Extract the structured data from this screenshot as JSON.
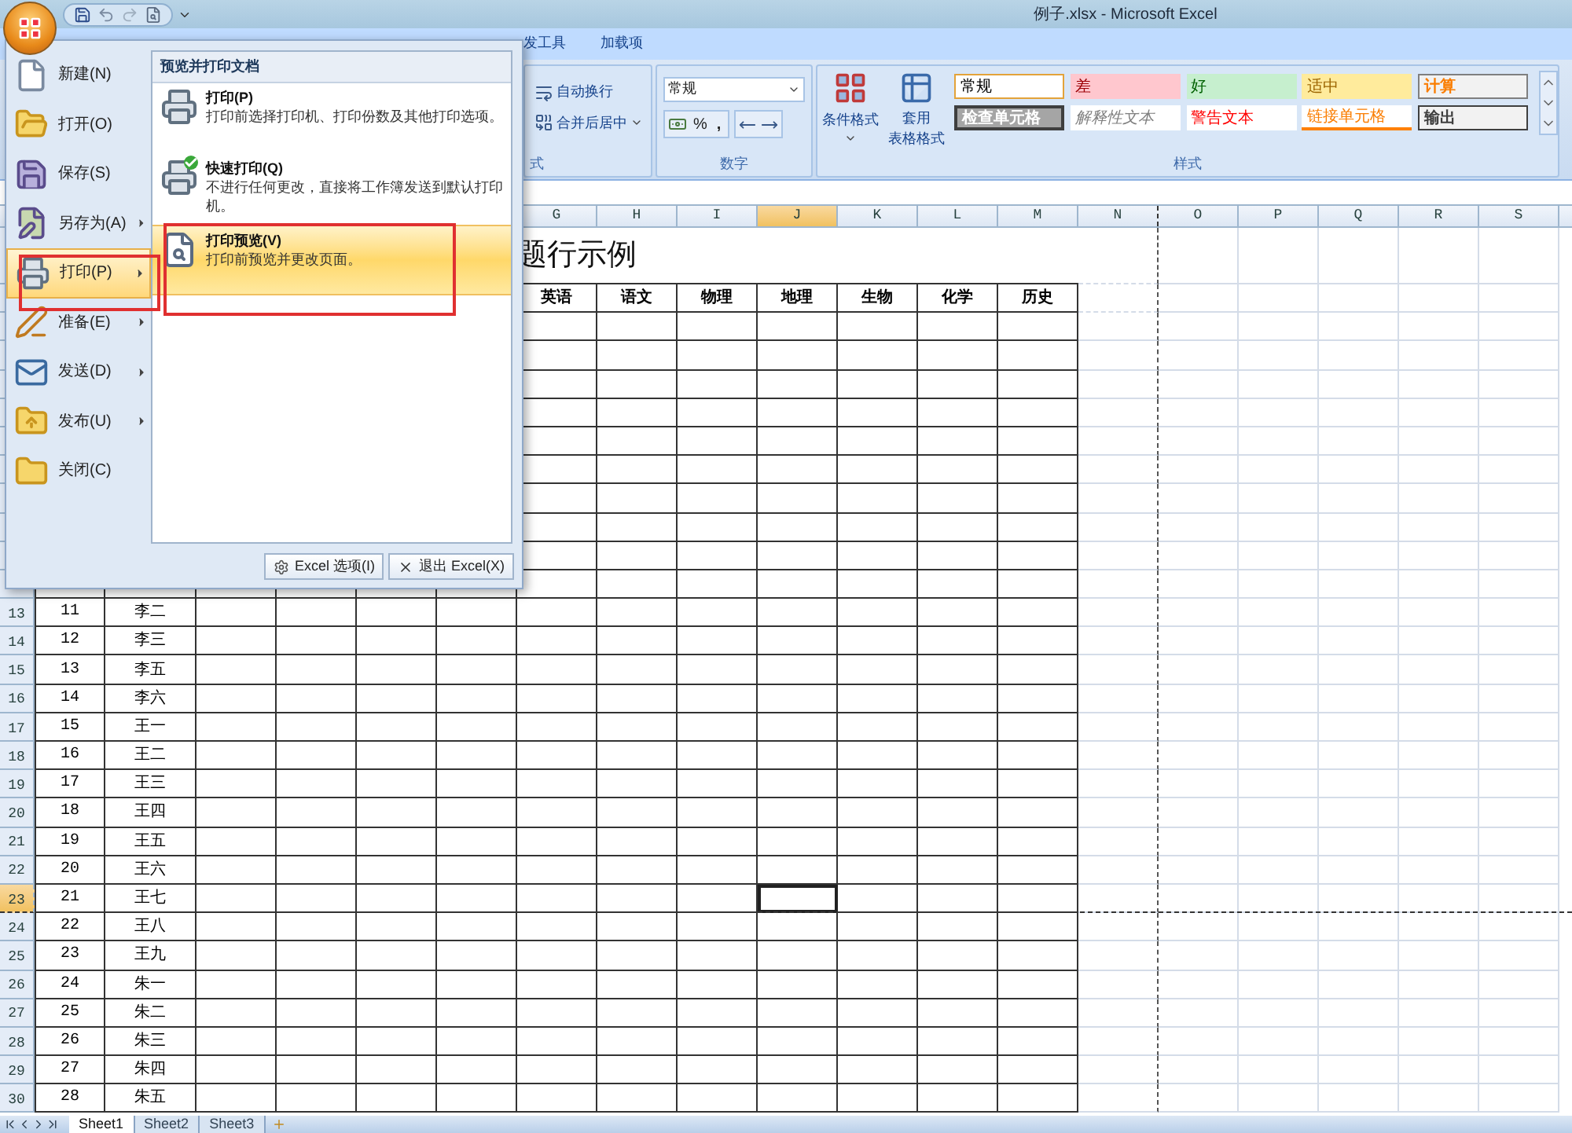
{
  "window": {
    "title": "例子.xlsx - Microsoft Excel"
  },
  "ribbon_tabs": [
    "发工具",
    "加载项"
  ],
  "ribbon": {
    "alignment_group": {
      "label": "式",
      "wrap_button": "自动换行",
      "merge_button": "合并后居中"
    },
    "number_group": {
      "label": "数字",
      "format": "常规",
      "percent_button": "%",
      "comma_button": ","
    },
    "styles_group": {
      "label": "样式",
      "conditional_button": "条件格式",
      "table_button": [
        "套用",
        "表格格式"
      ],
      "cell_styles": [
        {
          "label": "常规",
          "kind": "normal"
        },
        {
          "label": "差",
          "kind": "bad"
        },
        {
          "label": "好",
          "kind": "good"
        },
        {
          "label": "适中",
          "kind": "neutral"
        },
        {
          "label": "计算",
          "kind": "calculation"
        },
        {
          "label": "检查单元格",
          "kind": "check"
        },
        {
          "label": "解释性文本",
          "kind": "explanatory"
        },
        {
          "label": "警告文本",
          "kind": "warning"
        },
        {
          "label": "链接单元格",
          "kind": "linked"
        },
        {
          "label": "输出",
          "kind": "output"
        }
      ]
    }
  },
  "file_menu": {
    "items": [
      {
        "label": "新建(N)",
        "kind": "new",
        "has_submenu": false,
        "selected": false
      },
      {
        "label": "打开(O)",
        "kind": "open",
        "has_submenu": false,
        "selected": false
      },
      {
        "label": "保存(S)",
        "kind": "save",
        "has_submenu": false,
        "selected": false
      },
      {
        "label": "另存为(A)",
        "kind": "saveas",
        "has_submenu": true,
        "selected": false
      },
      {
        "label": "打印(P)",
        "kind": "print",
        "has_submenu": true,
        "selected": true
      },
      {
        "label": "准备(E)",
        "kind": "prepare",
        "has_submenu": true,
        "selected": false
      },
      {
        "label": "发送(D)",
        "kind": "send",
        "has_submenu": true,
        "selected": false
      },
      {
        "label": "发布(U)",
        "kind": "publish",
        "has_submenu": true,
        "selected": false
      },
      {
        "label": "关闭(C)",
        "kind": "close",
        "has_submenu": false,
        "selected": false
      }
    ],
    "submenu": {
      "title": "预览并打印文档",
      "items": [
        {
          "label": "打印(P)",
          "kind": "print",
          "description": "打印前选择打印机、打印份数及其他打印选项。",
          "selected": false
        },
        {
          "label": "快速打印(Q)",
          "kind": "quick",
          "description": "不进行任何更改，直接将工作簿发送到默认打印机。",
          "selected": false
        },
        {
          "label": "打印预览(V)",
          "kind": "preview",
          "description": "打印前预览并更改页面。",
          "selected": true
        }
      ]
    },
    "options_button": "Excel 选项(I)",
    "exit_button": "退出 Excel(X)"
  },
  "sheet": {
    "title": "题行示例",
    "headers": [
      "英语",
      "语文",
      "物理",
      "地理",
      "生物",
      "化学",
      "历史"
    ],
    "columns": [
      {
        "label": "G",
        "selected": false,
        "page_break": false
      },
      {
        "label": "H",
        "selected": false,
        "page_break": false
      },
      {
        "label": "I",
        "selected": false,
        "page_break": false
      },
      {
        "label": "J",
        "selected": true,
        "page_break": false
      },
      {
        "label": "K",
        "selected": false,
        "page_break": false
      },
      {
        "label": "L",
        "selected": false,
        "page_break": false
      },
      {
        "label": "M",
        "selected": false,
        "page_break": false
      },
      {
        "label": "N",
        "selected": false,
        "page_break": true
      },
      {
        "label": "O",
        "selected": false,
        "page_break": false
      },
      {
        "label": "P",
        "selected": false,
        "page_break": false
      },
      {
        "label": "Q",
        "selected": false,
        "page_break": false
      },
      {
        "label": "R",
        "selected": false,
        "page_break": false
      },
      {
        "label": "S",
        "selected": false,
        "page_break": false
      }
    ],
    "rows": [
      {
        "number": "13",
        "id": "11",
        "name": "李二",
        "selected": false,
        "page_break": false
      },
      {
        "number": "14",
        "id": "12",
        "name": "李三",
        "selected": false,
        "page_break": false
      },
      {
        "number": "15",
        "id": "13",
        "name": "李五",
        "selected": false,
        "page_break": false
      },
      {
        "number": "16",
        "id": "14",
        "name": "李六",
        "selected": false,
        "page_break": false
      },
      {
        "number": "17",
        "id": "15",
        "name": "王一",
        "selected": false,
        "page_break": false
      },
      {
        "number": "18",
        "id": "16",
        "name": "王二",
        "selected": false,
        "page_break": false
      },
      {
        "number": "19",
        "id": "17",
        "name": "王三",
        "selected": false,
        "page_break": false
      },
      {
        "number": "20",
        "id": "18",
        "name": "王四",
        "selected": false,
        "page_break": false
      },
      {
        "number": "21",
        "id": "19",
        "name": "王五",
        "selected": false,
        "page_break": false
      },
      {
        "number": "22",
        "id": "20",
        "name": "王六",
        "selected": false,
        "page_break": false
      },
      {
        "number": "23",
        "id": "21",
        "name": "王七",
        "selected": true,
        "page_break": true
      },
      {
        "number": "24",
        "id": "22",
        "name": "王八",
        "selected": false,
        "page_break": false
      },
      {
        "number": "25",
        "id": "23",
        "name": "王九",
        "selected": false,
        "page_break": false
      },
      {
        "number": "26",
        "id": "24",
        "name": "朱一",
        "selected": false,
        "page_break": false
      },
      {
        "number": "27",
        "id": "25",
        "name": "朱二",
        "selected": false,
        "page_break": false
      },
      {
        "number": "28",
        "id": "26",
        "name": "朱三",
        "selected": false,
        "page_break": false
      },
      {
        "number": "29",
        "id": "27",
        "name": "朱四",
        "selected": false,
        "page_break": false
      },
      {
        "number": "30",
        "id": "28",
        "name": "朱五",
        "selected": false,
        "page_break": false
      }
    ]
  },
  "sheet_tabs": [
    {
      "label": "Sheet1",
      "selected": true
    },
    {
      "label": "Sheet2",
      "selected": false
    },
    {
      "label": "Sheet3",
      "selected": false
    }
  ]
}
